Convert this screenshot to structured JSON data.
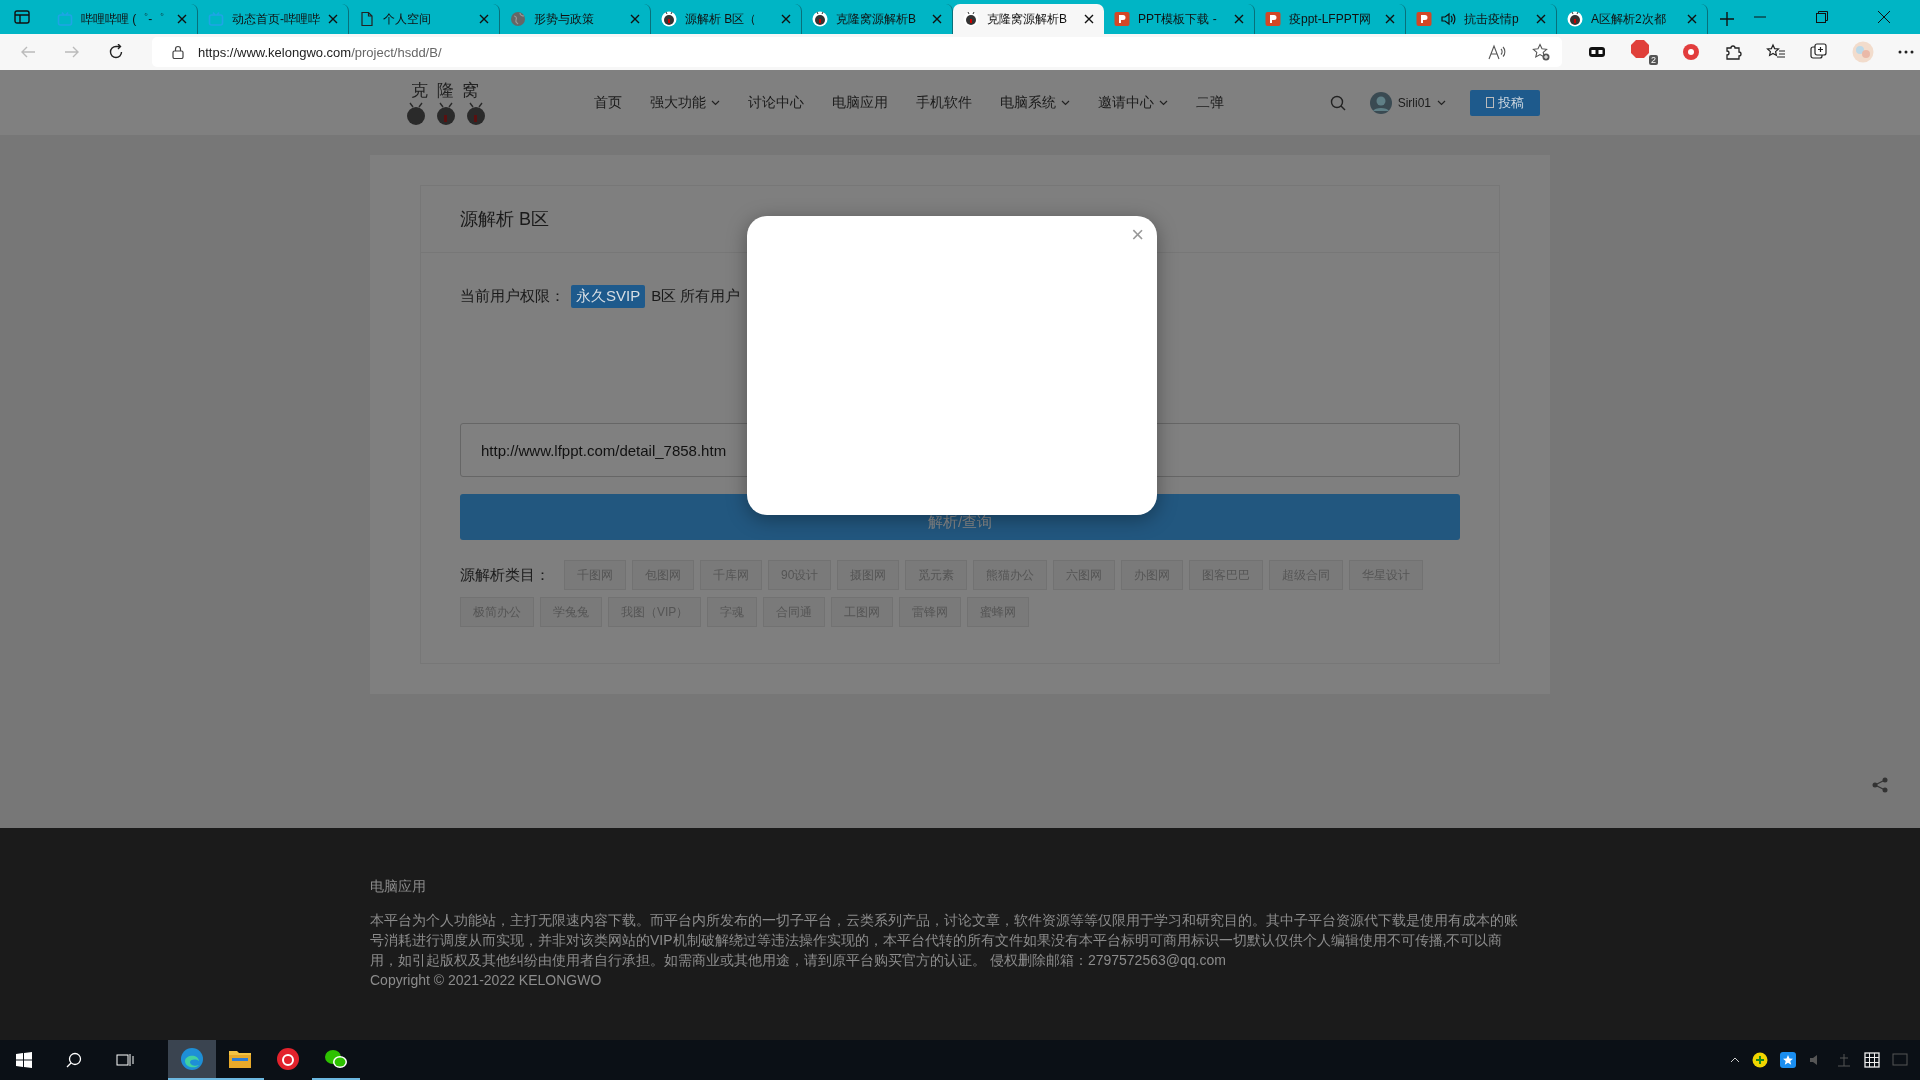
{
  "browser": {
    "tabs": [
      {
        "title": "哔哩哔哩 (゜-゜",
        "kind": "bili",
        "audio": false,
        "selected": false
      },
      {
        "title": "动态首页-哔哩哔",
        "kind": "bili",
        "audio": false,
        "selected": false
      },
      {
        "title": "个人空间",
        "kind": "doc",
        "audio": false,
        "selected": false
      },
      {
        "title": "形势与政策",
        "kind": "globe",
        "audio": false,
        "selected": false
      },
      {
        "title": "源解析 B区（",
        "kind": "site",
        "audio": false,
        "selected": false
      },
      {
        "title": "克隆窝源解析B",
        "kind": "site",
        "audio": false,
        "selected": false
      },
      {
        "title": "克隆窝源解析B",
        "kind": "site",
        "audio": false,
        "selected": true
      },
      {
        "title": "PPT模板下载 -",
        "kind": "ppt",
        "audio": false,
        "selected": false
      },
      {
        "title": "疫ppt-LFPPT网",
        "kind": "ppt",
        "audio": false,
        "selected": false
      },
      {
        "title": "抗击疫情p",
        "kind": "ppt",
        "audio": true,
        "selected": false
      },
      {
        "title": "A区解析2次都",
        "kind": "site",
        "audio": false,
        "selected": false
      }
    ],
    "address": {
      "host": "https://www.kelongwo.com",
      "path": "/project/hsdd/B/"
    },
    "extension_badge": "2"
  },
  "site": {
    "logo": "克 隆 窝",
    "nav": [
      {
        "label": "首页",
        "dropdown": false
      },
      {
        "label": "强大功能",
        "dropdown": true
      },
      {
        "label": "讨论中心",
        "dropdown": false
      },
      {
        "label": "电脑应用",
        "dropdown": false
      },
      {
        "label": "手机软件",
        "dropdown": false
      },
      {
        "label": "电脑系统",
        "dropdown": true
      },
      {
        "label": "邀请中心",
        "dropdown": true
      },
      {
        "label": "二弹",
        "dropdown": false
      }
    ],
    "user": "Sirli01",
    "submit": "投稿"
  },
  "panel": {
    "title": "源解析 B区",
    "permission_label": "当前用户权限：",
    "badge": "永久SVIP",
    "permission_note": "B区 所有用户",
    "url": {
      "value": "http://www.lfppt.com/detail_7858.htm"
    },
    "submit": "解析/查询",
    "categories_label": "源解析类目：",
    "categories": [
      "千图网",
      "包图网",
      "千库网",
      "90设计",
      "摄图网",
      "觅元素",
      "熊猫办公",
      "六图网",
      "办图网",
      "图客巴巴",
      "超级合同",
      "华星设计",
      "极简办公",
      "学兔兔",
      "我图（VIP）",
      "字魂",
      "合同通",
      "工图网",
      "雷锋网",
      "蜜蜂网"
    ]
  },
  "footer": {
    "title": "电脑应用",
    "text": "本平台为个人功能站，主打无限速内容下载。而平台内所发布的一切子平台，云类系列产品，讨论文章，软件资源等等仅限用于学习和研究目的。其中子平台资源代下载是使用有成本的账号消耗进行调度从而实现，并非对该类网站的VIP机制破解绕过等违法操作实现的，本平台代转的所有文件如果没有本平台标明可商用标识一切默认仅供个人编辑使用不可传播,不可以商用，如引起版权及其他纠纷由使用者自行承担。如需商业或其他用途，请到原平台购买官方的认证。 侵权删除邮箱：2797572563@qq.com",
    "copyright": "Copyright © 2021-2022 KELONGWO"
  },
  "modal": {
    "close": "×"
  },
  "taskbar": {
    "apps": [
      {
        "kind": "edge",
        "active": true,
        "running": true
      },
      {
        "kind": "folder",
        "active": false,
        "running": true
      },
      {
        "kind": "music",
        "active": false,
        "running": false
      },
      {
        "kind": "chat",
        "active": false,
        "running": true
      }
    ]
  }
}
